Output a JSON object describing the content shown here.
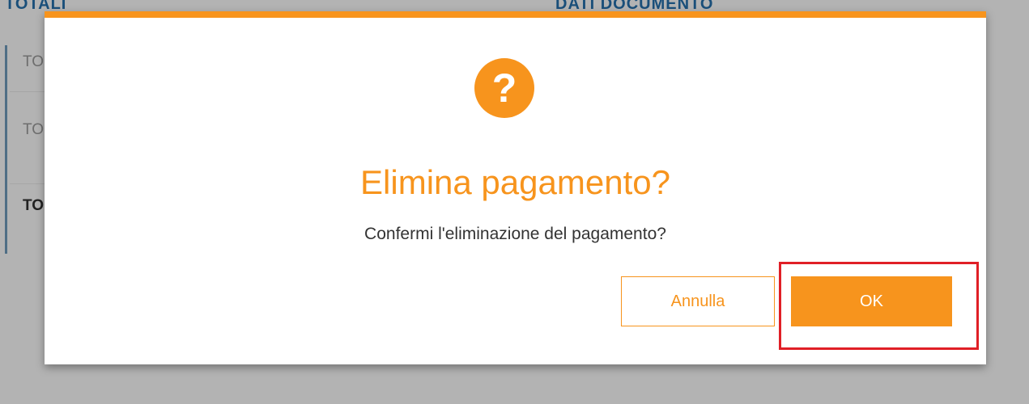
{
  "background": {
    "header_left": "TOTALI",
    "header_right": "DATI DOCUMENTO",
    "rows": [
      "TO",
      "TO",
      "TO"
    ]
  },
  "dialog": {
    "icon": "question-icon",
    "icon_glyph": "?",
    "title": "Elimina pagamento?",
    "message": "Confermi l'eliminazione del pagamento?",
    "cancel_label": "Annulla",
    "ok_label": "OK"
  },
  "colors": {
    "accent": "#f7941d",
    "highlight": "#e01f26",
    "overlay": "#b3b3b3"
  }
}
